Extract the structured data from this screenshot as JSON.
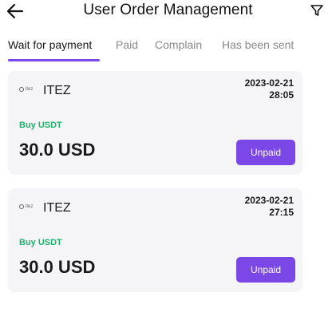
{
  "header": {
    "title": "User Order Management"
  },
  "tabs": [
    {
      "label": "Wait for payment",
      "active": true
    },
    {
      "label": "Paid",
      "active": false
    },
    {
      "label": "Complain",
      "active": false
    },
    {
      "label": "Has been sent",
      "active": false
    }
  ],
  "orders": [
    {
      "merchant": "ITEZ",
      "logo_text": "itez",
      "date": "2023-02-21",
      "time": "28:05",
      "type_label": "Buy USDT",
      "amount": "30.0 USD",
      "status": "Unpaid"
    },
    {
      "merchant": "ITEZ",
      "logo_text": "itez",
      "date": "2023-02-21",
      "time": "27:15",
      "type_label": "Buy USDT",
      "amount": "30.0 USD",
      "status": "Unpaid"
    }
  ],
  "colors": {
    "accent": "#7b47e6",
    "buy_label": "#1db36b",
    "card_bg": "#f5f5f7"
  }
}
